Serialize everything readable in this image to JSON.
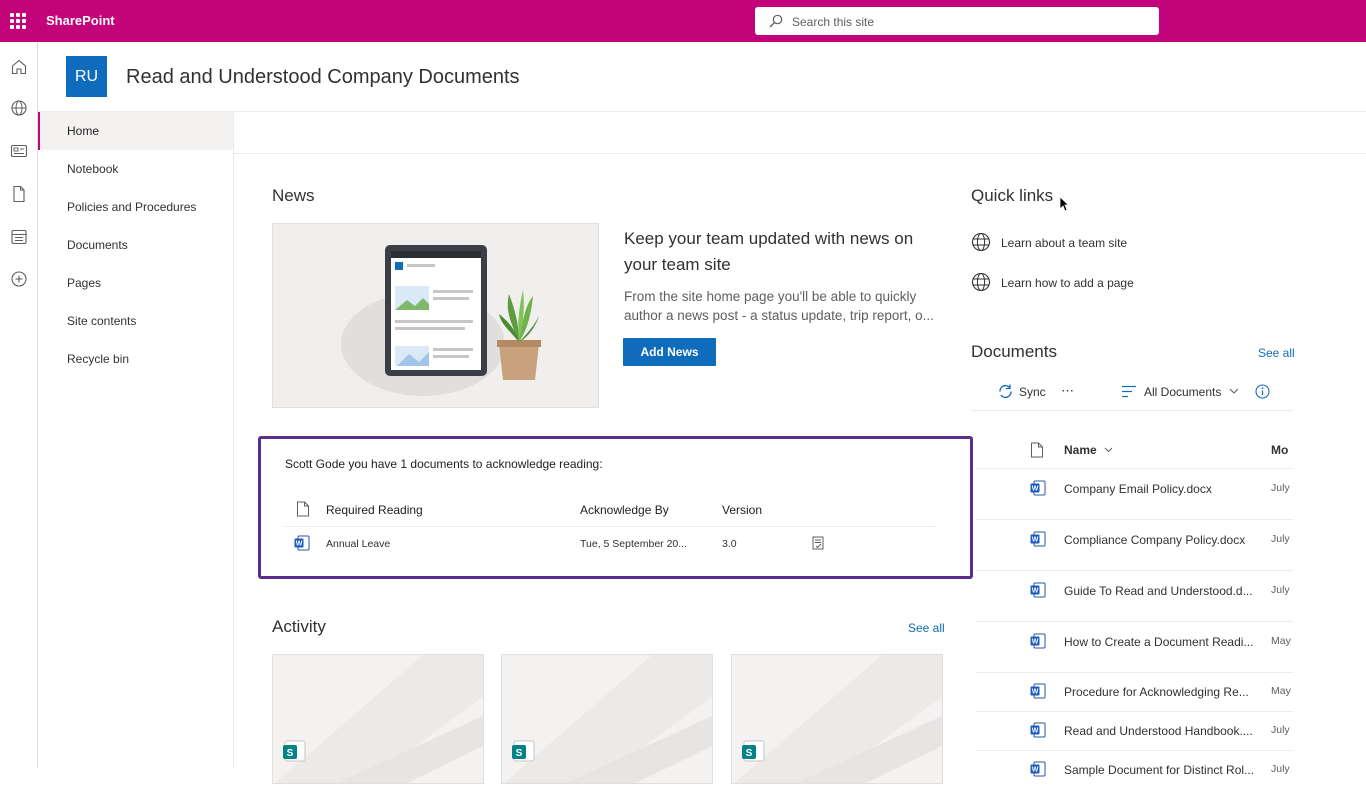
{
  "app": {
    "name": "SharePoint"
  },
  "search": {
    "placeholder": "Search this site"
  },
  "rail": {
    "icons": [
      "home-icon",
      "globe-icon",
      "news-icon",
      "file-icon",
      "list-icon",
      "add-icon"
    ]
  },
  "site": {
    "logo_initials": "RU",
    "title": "Read and Understood Company Documents"
  },
  "nav": {
    "items": [
      {
        "label": "Home",
        "selected": true
      },
      {
        "label": "Notebook"
      },
      {
        "label": "Policies and Procedures"
      },
      {
        "label": "Documents"
      },
      {
        "label": "Pages"
      },
      {
        "label": "Site contents"
      },
      {
        "label": "Recycle bin"
      }
    ]
  },
  "news": {
    "heading": "News",
    "headline": "Keep your team updated with news on your team site",
    "body": "From the site home page you'll be able to quickly author a news post - a status update, trip report, o...",
    "add_button": "Add News"
  },
  "acknowledge": {
    "message": "Scott Gode you have 1 documents to acknowledge reading:",
    "columns": {
      "doc": "Required Reading",
      "by": "Acknowledge By",
      "version": "Version"
    },
    "rows": [
      {
        "name": "Annual Leave",
        "by": "Tue, 5 September 20...",
        "version": "3.0"
      }
    ]
  },
  "activity": {
    "heading": "Activity",
    "see_all": "See all"
  },
  "quicklinks": {
    "heading": "Quick links",
    "items": [
      "Learn about a team site",
      "Learn how to add a page"
    ]
  },
  "documents": {
    "heading": "Documents",
    "see_all": "See all",
    "sync": "Sync",
    "more": "⋯",
    "view": "All Documents",
    "col_name": "Name",
    "col_modified": "Mo",
    "rows": [
      {
        "name": "Company Email Policy.docx",
        "modified": "July"
      },
      {
        "name": "Compliance Company Policy.docx",
        "modified": "July"
      },
      {
        "name": "Guide To Read and Understood.d...",
        "modified": "July"
      },
      {
        "name": "How to Create a Document Readi...",
        "modified": "May"
      },
      {
        "name": "Procedure for Acknowledging Re...",
        "modified": "May"
      },
      {
        "name": "Read and Understood Handbook....",
        "modified": "July"
      },
      {
        "name": "Sample Document for Distinct Rol...",
        "modified": "July"
      }
    ]
  },
  "colors": {
    "suite_bar": "#c20379",
    "accent": "#0f6cbd",
    "highlight_border": "#5c2d91"
  }
}
